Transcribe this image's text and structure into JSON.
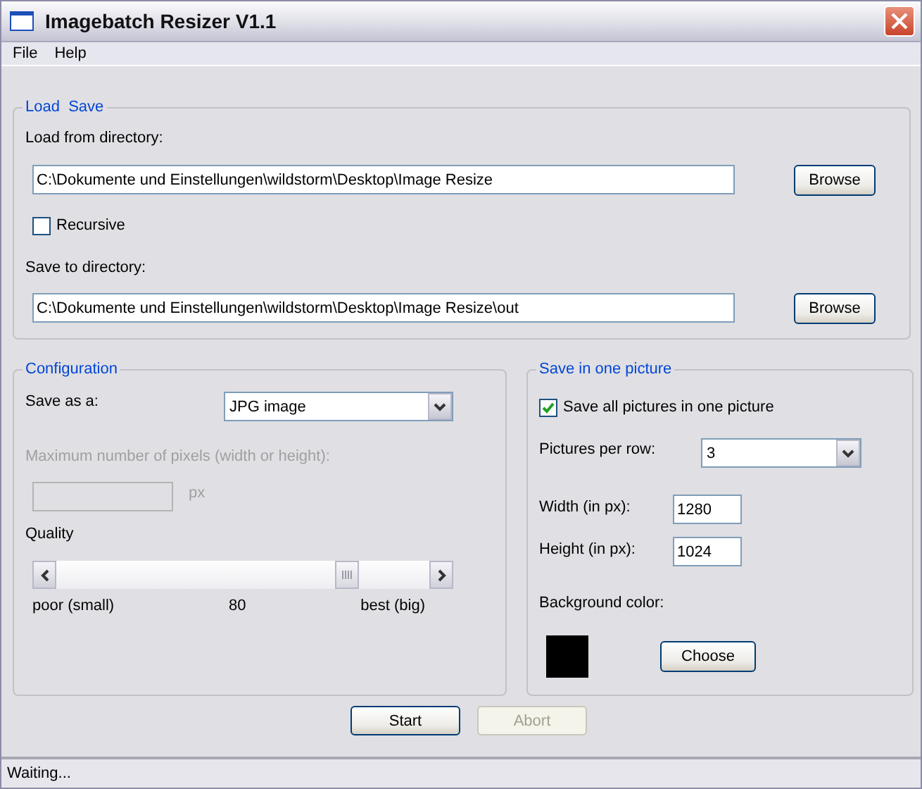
{
  "window": {
    "title": "Imagebatch Resizer V1.1"
  },
  "menu": [
    "File",
    "Help"
  ],
  "load_save": {
    "title": "Load  Save",
    "load_label": "Load from directory:",
    "load_path": "C:\\Dokumente und Einstellungen\\wildstorm\\Desktop\\Image Resize",
    "load_browse": "Browse",
    "recursive": {
      "label": "Recursive",
      "checked": false
    },
    "save_label": "Save to directory:",
    "save_path": "C:\\Dokumente und Einstellungen\\wildstorm\\Desktop\\Image Resize\\out",
    "save_browse": "Browse"
  },
  "configuration": {
    "title": "Configuration",
    "save_as_label": "Save as a:",
    "save_as_value": "JPG image",
    "max_pixels": {
      "label": "Maximum number of pixels (width or height):",
      "unit": "px",
      "disabled": true
    },
    "quality": {
      "label": "Quality",
      "level": 0.8,
      "min_label": "poor (small)",
      "reading": "80",
      "max_label": "best (big)"
    }
  },
  "one_picture": {
    "title": "Save in one picture",
    "save_all": {
      "label": "Save all pictures in one picture",
      "checked": true
    },
    "per_row_label": "Pictures per row:",
    "per_row_value": "3",
    "width_label": "Width (in px):",
    "width_value": "1280",
    "height_label": "Height (in px):",
    "height_value": "1024",
    "background": {
      "label": "Background color:",
      "color": "#000000"
    },
    "choose": "Choose"
  },
  "buttons": [
    {
      "label": "Start",
      "disabled": false
    },
    {
      "label": "Abort",
      "disabled": true
    }
  ],
  "status_bar": "Waiting..."
}
